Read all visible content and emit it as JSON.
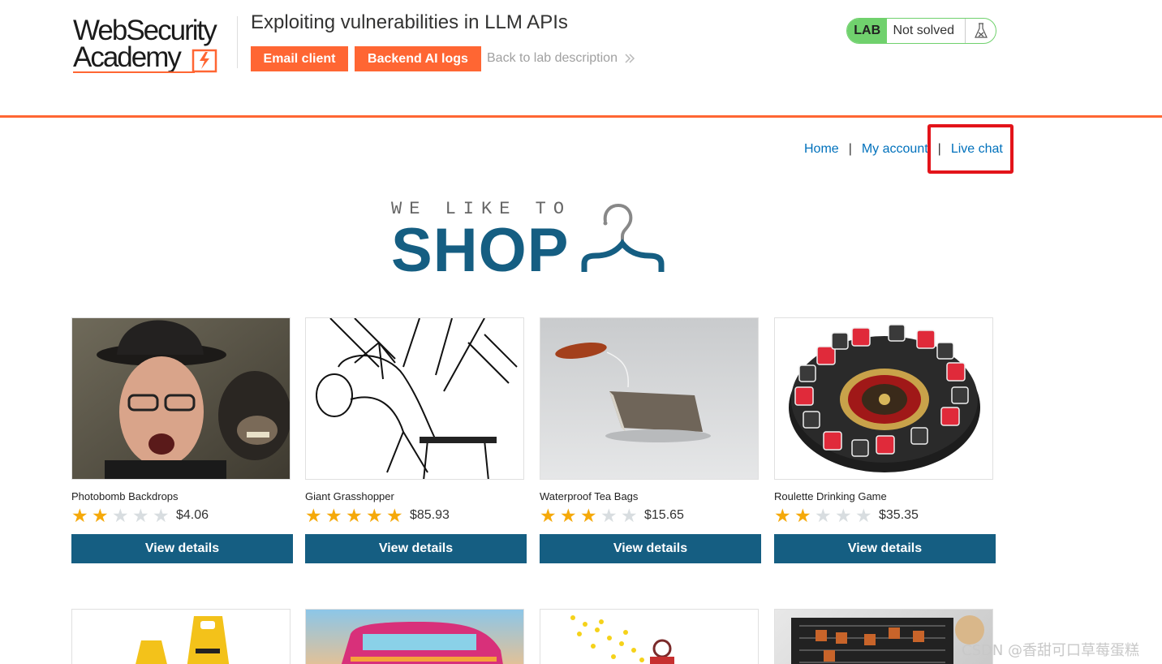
{
  "header": {
    "logo_line1": "WebSecurity",
    "logo_line2": "Academy",
    "lab_title": "Exploiting vulnerabilities in LLM APIs",
    "email_client_label": "Email client",
    "backend_logs_label": "Backend AI logs",
    "back_link_label": "Back to lab description",
    "lab_badge": "LAB",
    "status_text": "Not solved",
    "accent_color": "#ff6633",
    "status_color": "#70d16d"
  },
  "nav": {
    "home": "Home",
    "separator": "|",
    "my_account": "My account",
    "live_chat": "Live chat",
    "link_color": "#0071bc",
    "highlight_color": "#e3141a"
  },
  "banner": {
    "tagline": "WE LIKE TO",
    "title": "SHOP",
    "brand_color": "#155e82"
  },
  "products": [
    {
      "name": "Photobomb Backdrops",
      "rating": 2,
      "max_rating": 5,
      "price": "$4.06",
      "button": "View details"
    },
    {
      "name": "Giant Grasshopper",
      "rating": 5,
      "max_rating": 5,
      "price": "$85.93",
      "button": "View details"
    },
    {
      "name": "Waterproof Tea Bags",
      "rating": 3,
      "max_rating": 5,
      "price": "$15.65",
      "button": "View details"
    },
    {
      "name": "Roulette Drinking Game",
      "rating": 2,
      "max_rating": 5,
      "price": "$35.35",
      "button": "View details"
    }
  ],
  "watermark": "CSDN @香甜可口草莓蛋糕"
}
